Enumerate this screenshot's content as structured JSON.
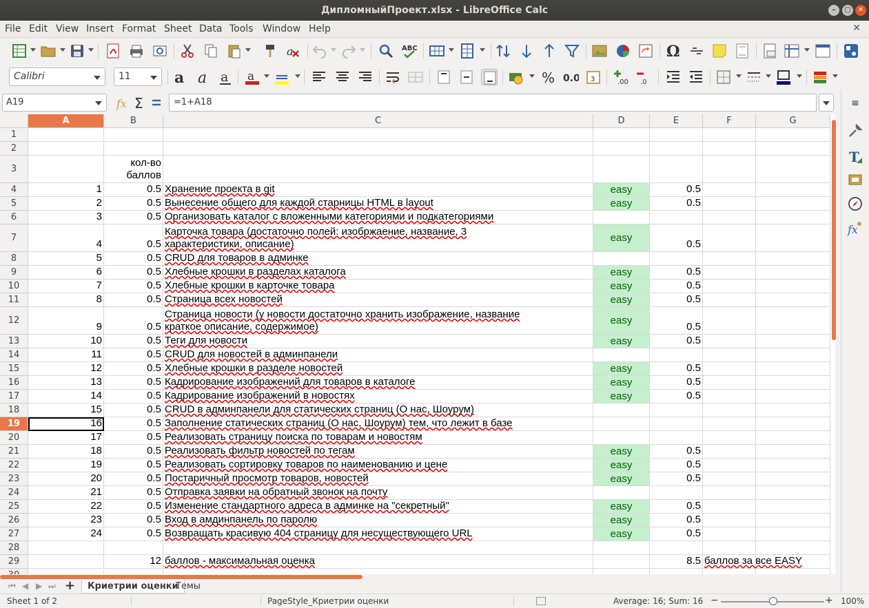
{
  "window": {
    "title": "ДипломныйПроект.xlsx - LibreOffice Calc"
  },
  "menu": [
    "File",
    "Edit",
    "View",
    "Insert",
    "Format",
    "Sheet",
    "Data",
    "Tools",
    "Window",
    "Help"
  ],
  "format": {
    "font_name": "Calibri",
    "font_size": "11"
  },
  "formula_bar": {
    "cell_ref": "A19",
    "formula": "=1+A18"
  },
  "columns": [
    "A",
    "B",
    "C",
    "D",
    "E",
    "F",
    "G"
  ],
  "rows": [
    {
      "n": "1"
    },
    {
      "n": "2"
    },
    {
      "n": "3",
      "B1": "кол-во",
      "B2": "баллов"
    },
    {
      "n": "4",
      "A": "1",
      "B": "0.5",
      "C": "Хранение проекта в git",
      "D": "easy",
      "E": "0.5"
    },
    {
      "n": "5",
      "A": "2",
      "B": "0.5",
      "C": "Вынесение общего для каждой старницы HTML в layout",
      "D": "easy",
      "E": "0.5"
    },
    {
      "n": "6",
      "A": "3",
      "B": "0.5",
      "C": "Организовать каталог с вложенными категориями и подкатегориями"
    },
    {
      "n": "7",
      "A": "4",
      "B": "0.5",
      "C1": "Карточка товара (достаточно полей: изобржаение, название, 3",
      "C2": "характеристики, описание)",
      "D": "easy",
      "E": "0.5"
    },
    {
      "n": "8",
      "A": "5",
      "B": "0.5",
      "C": "CRUD для товаров в админке"
    },
    {
      "n": "9",
      "A": "6",
      "B": "0.5",
      "C": "Хлебные крошки в разделах каталога",
      "D": "easy",
      "E": "0.5"
    },
    {
      "n": "10",
      "A": "7",
      "B": "0.5",
      "C": "Хлебные крошки в карточке товара",
      "D": "easy",
      "E": "0.5"
    },
    {
      "n": "11",
      "A": "8",
      "B": "0.5",
      "C": "Страница всех новостей",
      "D": "easy",
      "E": "0.5"
    },
    {
      "n": "12",
      "A": "9",
      "B": "0.5",
      "C1": "Страница новости (у новости достаточно хранить изображение, название",
      "C2": "краткое описание, содержимое)",
      "D": "easy",
      "E": "0.5"
    },
    {
      "n": "13",
      "A": "10",
      "B": "0.5",
      "C": "Теги для новости",
      "D": "easy",
      "E": "0.5"
    },
    {
      "n": "14",
      "A": "11",
      "B": "0.5",
      "C": "CRUD для новостей в админпанели"
    },
    {
      "n": "15",
      "A": "12",
      "B": "0.5",
      "C": "Хлебные крошки в разделе новостей",
      "D": "easy",
      "E": "0.5"
    },
    {
      "n": "16",
      "A": "13",
      "B": "0.5",
      "C": "Кадрирование изображений для товаров в каталоге",
      "D": "easy",
      "E": "0.5"
    },
    {
      "n": "17",
      "A": "14",
      "B": "0.5",
      "C": "Кадрирование изображений в новостях",
      "D": "easy",
      "E": "0.5"
    },
    {
      "n": "18",
      "A": "15",
      "B": "0.5",
      "C": "CRUD в админпанели для статических страниц (О нас, Шоурум)"
    },
    {
      "n": "19",
      "A": "16",
      "B": "0.5",
      "C": "Заполнение  статических страниц (О нас, Шоурум) тем, что лежит в базе"
    },
    {
      "n": "20",
      "A": "17",
      "B": "0.5",
      "C": "Реализовать страницу поиска по товарам и новостям"
    },
    {
      "n": "21",
      "A": "18",
      "B": "0.5",
      "C": "Реализовать фильтр новостей по тегам",
      "D": "easy",
      "E": "0.5"
    },
    {
      "n": "22",
      "A": "19",
      "B": "0.5",
      "C": "Реализовать сортировку товаров по наименованию и цене",
      "D": "easy",
      "E": "0.5"
    },
    {
      "n": "23",
      "A": "20",
      "B": "0.5",
      "C": "Постаричный просмотр товаров, новостей",
      "D": "easy",
      "E": "0.5"
    },
    {
      "n": "24",
      "A": "21",
      "B": "0.5",
      "C": "Отправка заявки на обратный звонок на почту"
    },
    {
      "n": "25",
      "A": "22",
      "B": "0.5",
      "C": "Изменение стандартного адреса в админке на \"секретный\"",
      "D": "easy",
      "E": "0.5"
    },
    {
      "n": "26",
      "A": "23",
      "B": "0.5",
      "C": "Вход в амдинпанель по паролю",
      "D": "easy",
      "E": "0.5"
    },
    {
      "n": "27",
      "A": "24",
      "B": "0.5",
      "C": "Возвращать красивую 404 страницу для несуществующего URL",
      "D": "easy",
      "E": "0.5"
    },
    {
      "n": "28"
    },
    {
      "n": "29",
      "B": "12",
      "C": "баллов - максимальная оценка",
      "E": "8.5",
      "F": "баллов за все EASY"
    },
    {
      "n": "30"
    }
  ],
  "tabs": [
    "Криетрии оценки",
    "Темы"
  ],
  "status": {
    "sheet": "Sheet 1 of 2",
    "page_style": "PageStyle_Криетрии оценки",
    "summary": "Average: 16; Sum: 16",
    "zoom": "100%"
  },
  "colors": {
    "accent": "#e9774a",
    "easy_fill": "#c6efce",
    "title_bg": "#3c3b37"
  }
}
